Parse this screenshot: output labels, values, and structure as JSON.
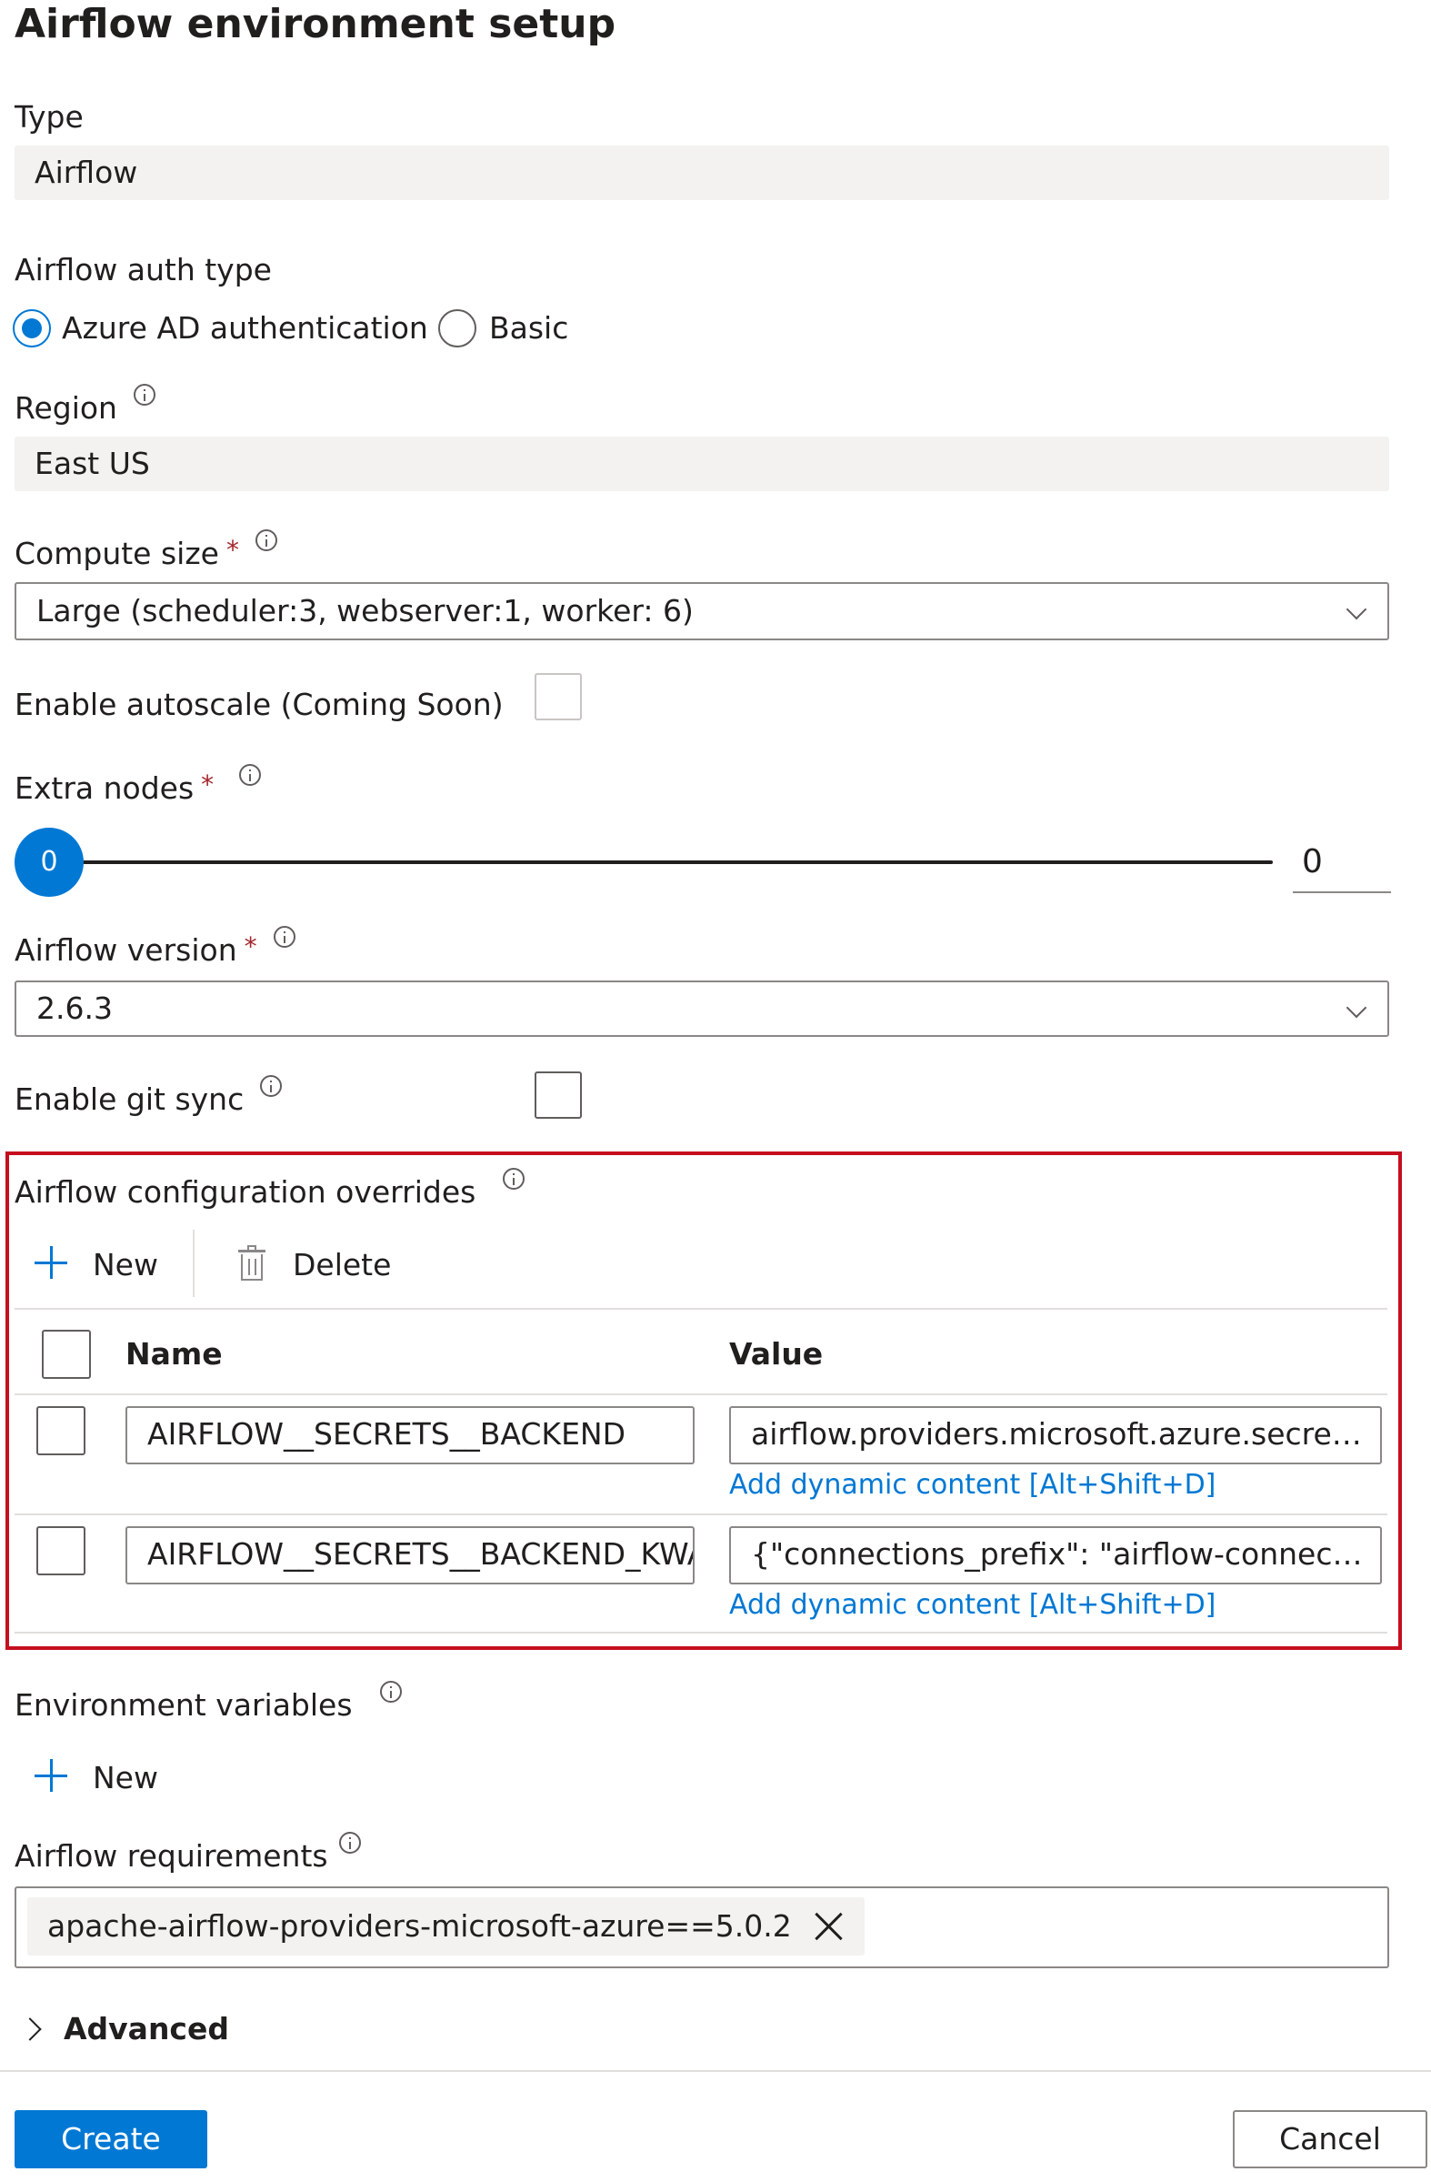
{
  "page": {
    "title": "Airflow environment setup"
  },
  "type": {
    "label": "Type",
    "value": "Airflow"
  },
  "auth": {
    "label": "Airflow auth type",
    "options": [
      {
        "label": "Azure AD authentication",
        "selected": true
      },
      {
        "label": "Basic",
        "selected": false
      }
    ]
  },
  "region": {
    "label": "Region",
    "value": "East US"
  },
  "compute": {
    "label": "Compute size",
    "required_mark": "*",
    "value": "Large (scheduler:3, webserver:1, worker: 6)"
  },
  "autoscale": {
    "label": "Enable autoscale (Coming Soon)",
    "checked": false,
    "disabled": true
  },
  "extra_nodes": {
    "label": "Extra nodes",
    "required_mark": "*",
    "thumb_value": "0",
    "value": "0"
  },
  "airflow_version": {
    "label": "Airflow version",
    "required_mark": "*",
    "value": "2.6.3"
  },
  "git_sync": {
    "label": "Enable git sync",
    "checked": false
  },
  "overrides": {
    "label": "Airflow configuration overrides",
    "new_label": "New",
    "delete_label": "Delete",
    "col_name": "Name",
    "col_value": "Value",
    "rows": [
      {
        "name": "AIRFLOW__SECRETS__BACKEND",
        "value": "airflow.providers.microsoft.azure.secrets....",
        "dynamic_link": "Add dynamic content [Alt+Shift+D]"
      },
      {
        "name": "AIRFLOW__SECRETS__BACKEND_KWA",
        "value": "{\"connections_prefix\": \"airflow-connectio...",
        "dynamic_link": "Add dynamic content [Alt+Shift+D]"
      }
    ]
  },
  "env_vars": {
    "label": "Environment variables",
    "new_label": "New"
  },
  "requirements": {
    "label": "Airflow requirements",
    "tags": [
      "apache-airflow-providers-microsoft-azure==5.0.2"
    ]
  },
  "advanced": {
    "label": "Advanced"
  },
  "footer": {
    "create_label": "Create",
    "cancel_label": "Cancel"
  },
  "colors": {
    "accent": "#0078d4",
    "highlight_border": "#c50f1f",
    "required": "#a4262c"
  }
}
